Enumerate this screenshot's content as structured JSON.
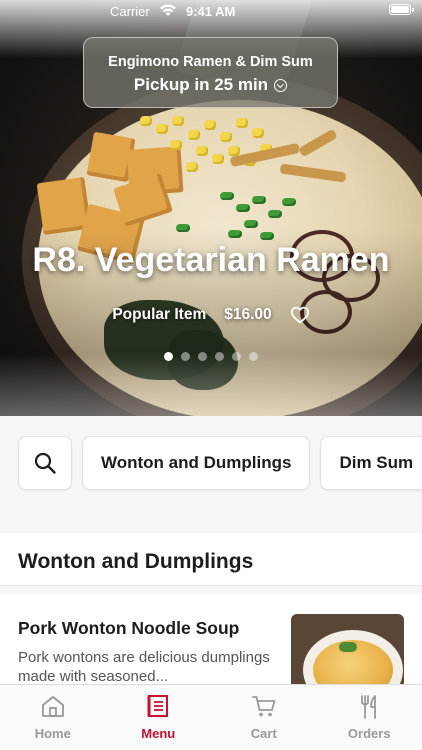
{
  "status_bar": {
    "carrier": "Carrier",
    "time": "9:41 AM"
  },
  "store": {
    "name": "Engimono Ramen & Dim Sum",
    "pickup": "Pickup in 25 min"
  },
  "featured": {
    "title": "R8. Vegetarian Ramen",
    "tag": "Popular Item",
    "price": "$16.00",
    "carousel_total": 6,
    "carousel_active": 1
  },
  "categories": [
    {
      "label": "Wonton and Dumplings"
    },
    {
      "label": "Dim Sum"
    }
  ],
  "section": {
    "title": "Wonton and Dumplings"
  },
  "menu_items": [
    {
      "name": "Pork Wonton Noodle Soup",
      "description": "Pork wontons are delicious dumplings made with seasoned..."
    }
  ],
  "tabs": [
    {
      "label": "Home",
      "icon": "home-icon",
      "active": false
    },
    {
      "label": "Menu",
      "icon": "menu-icon",
      "active": true
    },
    {
      "label": "Cart",
      "icon": "cart-icon",
      "active": false
    },
    {
      "label": "Orders",
      "icon": "orders-icon",
      "active": false
    }
  ],
  "colors": {
    "accent": "#c8102e",
    "inactive_tab": "#999999"
  }
}
